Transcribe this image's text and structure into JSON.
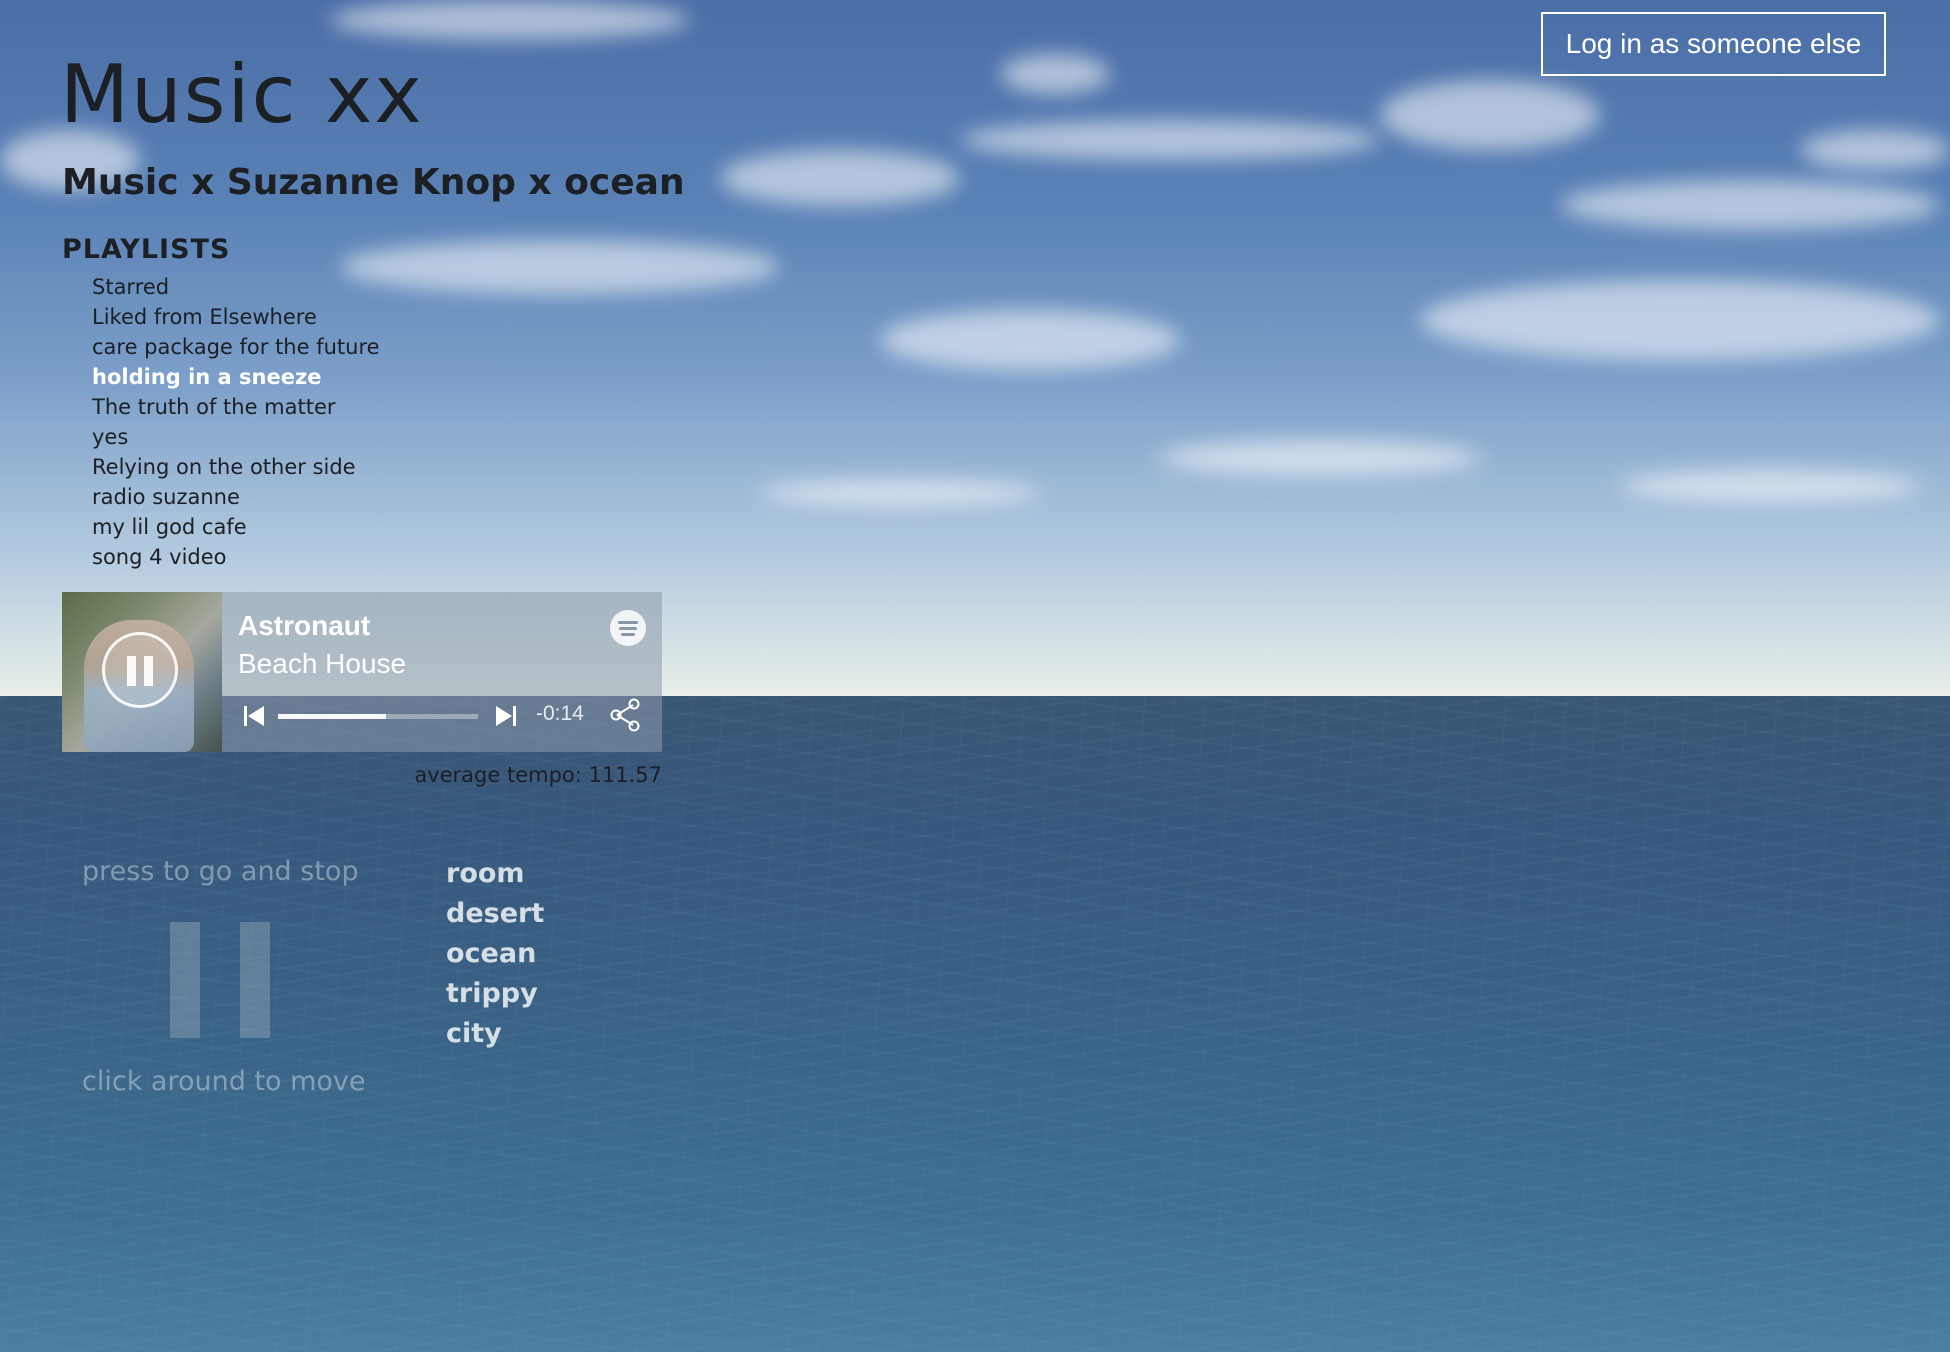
{
  "header": {
    "title": "Music xx",
    "subtitle": "Music x Suzanne Knop x ocean",
    "login_label": "Log in as someone else"
  },
  "playlists": {
    "heading": "PLAYLISTS",
    "items": [
      {
        "label": "Starred",
        "active": false
      },
      {
        "label": "Liked from Elsewhere",
        "active": false
      },
      {
        "label": "care package for the future",
        "active": false
      },
      {
        "label": "holding in a sneeze",
        "active": true
      },
      {
        "label": "The truth of the matter",
        "active": false
      },
      {
        "label": "yes",
        "active": false
      },
      {
        "label": "Relying on the other side",
        "active": false
      },
      {
        "label": "radio suzanne",
        "active": false
      },
      {
        "label": "my lil god cafe",
        "active": false
      },
      {
        "label": "song 4 video",
        "active": false
      }
    ]
  },
  "player": {
    "track": "Astronaut",
    "artist": "Beach House",
    "time_remaining": "-0:14",
    "progress": 0.54,
    "state": "playing",
    "icons": {
      "play_pause": "pause-icon",
      "brand": "spotify-icon",
      "prev": "skip-previous-icon",
      "next": "skip-next-icon",
      "share": "share-icon"
    }
  },
  "tempo": {
    "text": "average tempo: 111.57"
  },
  "controls": {
    "press_label": "press to go and stop",
    "click_label": "click around to move",
    "go_stop_icon": "pause-icon"
  },
  "scenes": {
    "items": [
      "room",
      "desert",
      "ocean",
      "trippy",
      "city"
    ]
  },
  "colors": {
    "text_dark": "#1c1f24",
    "active_playlist": "#ffffff",
    "sky_top": "#4a6ea6",
    "horizon": "#e9efe9",
    "sea": "#36587c"
  }
}
